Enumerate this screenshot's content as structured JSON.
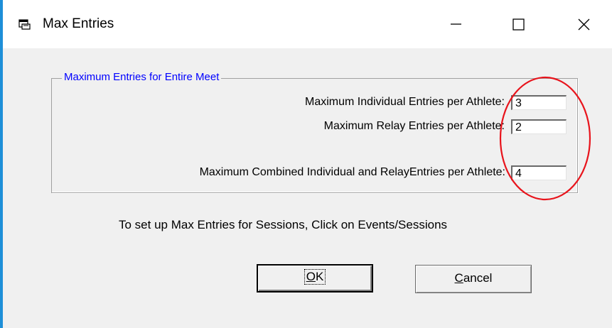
{
  "window": {
    "title": "Max Entries",
    "controls": [
      "minimize",
      "maximize",
      "close"
    ]
  },
  "group": {
    "legend": "Maximum Entries for Entire Meet",
    "individual_label": "Maximum Individual Entries per Athlete:",
    "individual_value": "3",
    "relay_label": "Maximum Relay Entries per Athlete:",
    "relay_value": "2",
    "combined_label": "Maximum  Combined Individual and RelayEntries per Athlete:",
    "combined_value": "4"
  },
  "hint": "To set up Max Entries for Sessions, Click on Events/Sessions",
  "buttons": {
    "ok_label": "OK",
    "ok_mnemonic": "O",
    "ok_rest": "K",
    "cancel_label": "Cancel",
    "cancel_mnemonic": "C",
    "cancel_rest": "ancel"
  },
  "annotation": {
    "shape": "ellipse",
    "color": "#e8141c"
  },
  "colors": {
    "legend": "#0000ff",
    "desktop": "#1e8fd8",
    "dialog": "#f0f0f0"
  }
}
